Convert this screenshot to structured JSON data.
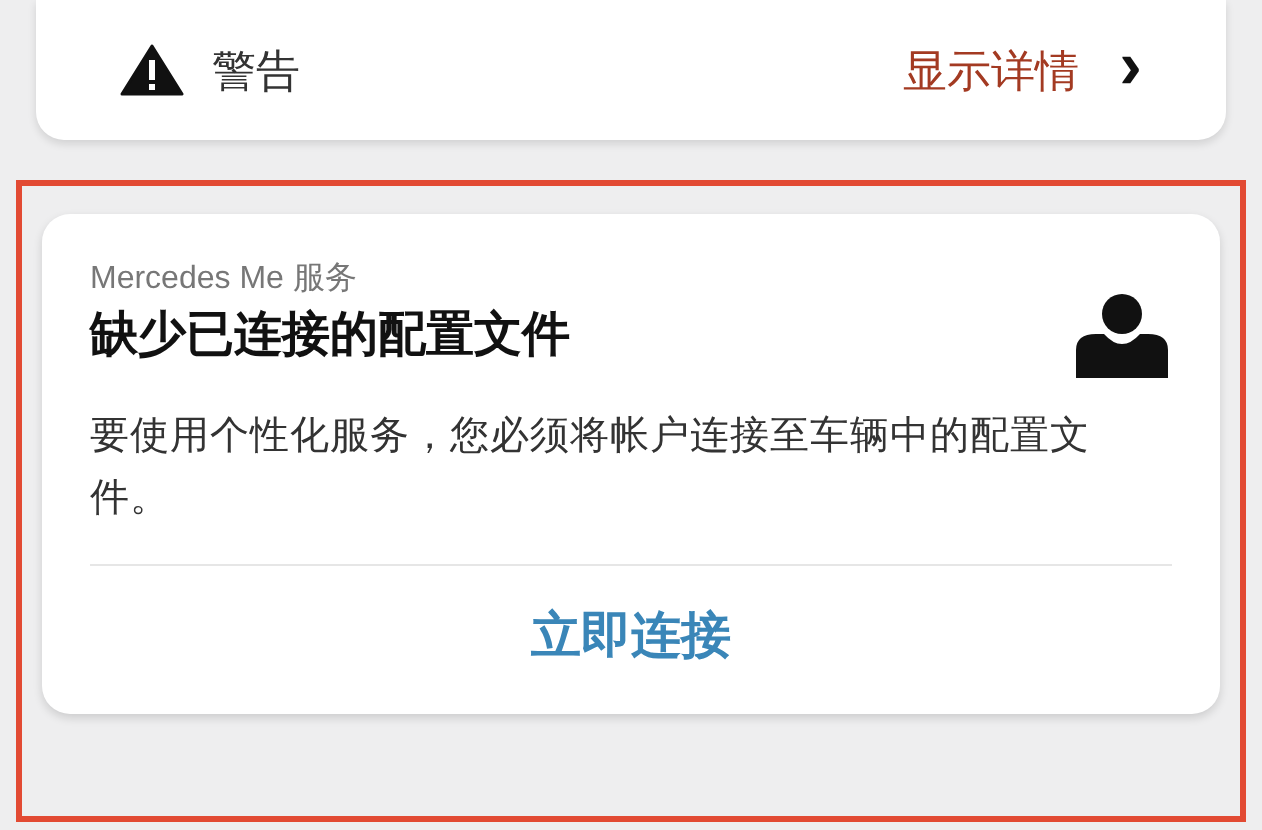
{
  "warning_card": {
    "label": "警告",
    "action": "显示详情",
    "chevron": "›"
  },
  "profile_card": {
    "service": "Mercedes Me 服务",
    "title": "缺少已连接的配置文件",
    "message": "要使用个性化服务，您必须将帐户连接至车辆中的配置文件。",
    "action": "立即连接",
    "highlighted": true
  }
}
